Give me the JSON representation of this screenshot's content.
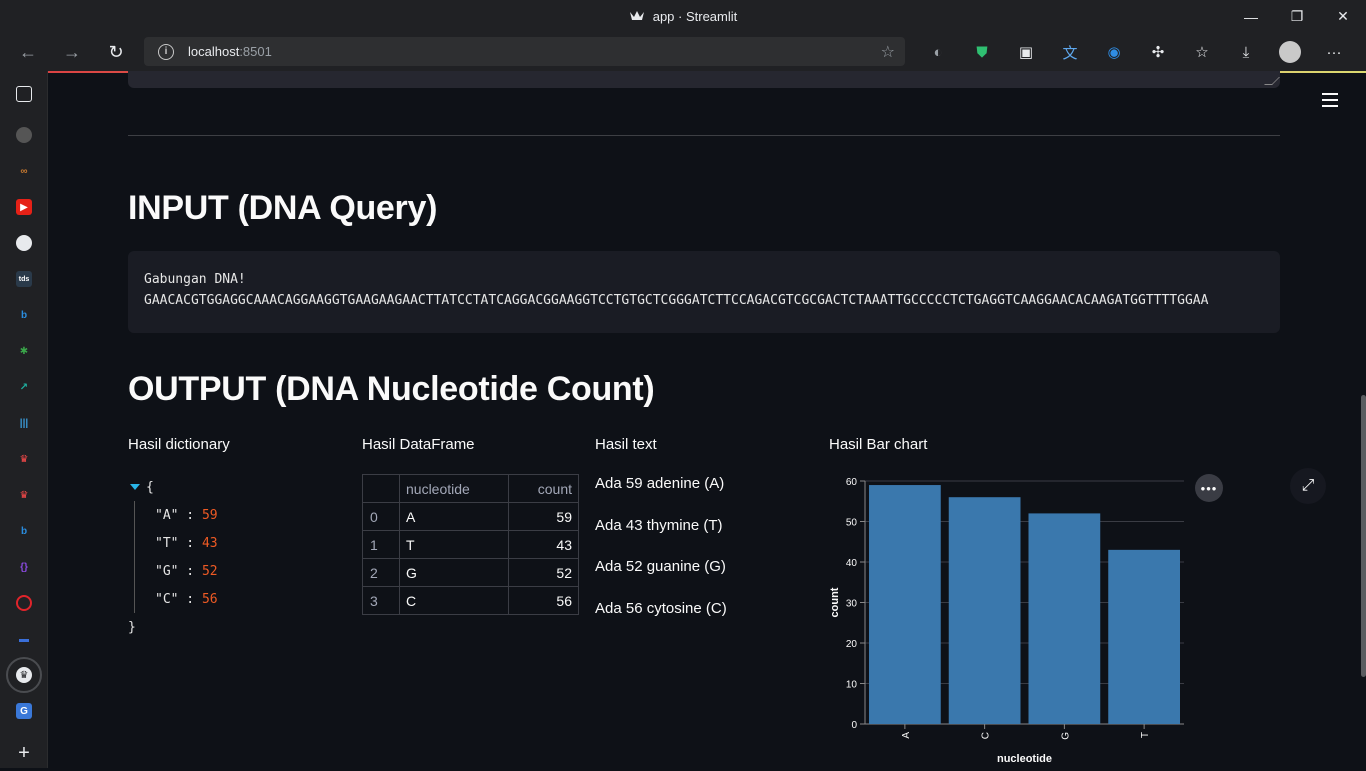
{
  "window": {
    "title": "app · Streamlit",
    "controls": [
      "—",
      "❐",
      "✕"
    ]
  },
  "toolbar": {
    "url_host": "localhost",
    "url_port": ":8501"
  },
  "sidebar_tabs": [
    "tab",
    "github",
    "link",
    "youtube",
    "github",
    "tds",
    "bing",
    "bug",
    "chart",
    "bars",
    "streamlit",
    "streamlit",
    "bing",
    "code",
    "opera",
    "line",
    "streamlit",
    "translate"
  ],
  "page": {
    "input_heading": "INPUT (DNA Query)",
    "code_line1": "Gabungan DNA!",
    "code_line2": "GAACACGTGGAGGCAAACAGGAAGGTGAAGAAGAACTTATCCTATCAGGACGGAAGGTCCTGTGCTCGGGATCTTCCAGACGTCGCGACTCTAAATTGCCCCCTCTGAGGTCAAGGAACACAAGATGGTTTTGGAA",
    "output_heading": "OUTPUT (DNA Nucleotide Count)",
    "dict_header": "Hasil dictionary",
    "df_header": "Hasil DataFrame",
    "text_header": "Hasil text",
    "chart_header": "Hasil Bar chart"
  },
  "dict": {
    "open": "{",
    "close": "}",
    "entries": [
      {
        "key": "\"A\"",
        "value": "59"
      },
      {
        "key": "\"T\"",
        "value": "43"
      },
      {
        "key": "\"G\"",
        "value": "52"
      },
      {
        "key": "\"C\"",
        "value": "56"
      }
    ]
  },
  "dataframe": {
    "columns": [
      "nucleotide",
      "count"
    ],
    "rows": [
      {
        "idx": "0",
        "nucleotide": "A",
        "count": "59"
      },
      {
        "idx": "1",
        "nucleotide": "T",
        "count": "43"
      },
      {
        "idx": "2",
        "nucleotide": "G",
        "count": "52"
      },
      {
        "idx": "3",
        "nucleotide": "C",
        "count": "56"
      }
    ]
  },
  "text_lines": [
    "Ada 59 adenine (A)",
    "Ada 43 thymine (T)",
    "Ada 52 guanine (G)",
    "Ada 56 cytosine (C)"
  ],
  "chart_data": {
    "type": "bar",
    "categories": [
      "A",
      "C",
      "G",
      "T"
    ],
    "values": [
      59,
      56,
      52,
      43
    ],
    "xlabel": "nucleotide",
    "ylabel": "count",
    "ylim": [
      0,
      60
    ],
    "yticks": [
      0,
      10,
      20,
      30,
      40,
      50,
      60
    ],
    "bar_color": "#3a78ad",
    "grid": true
  }
}
